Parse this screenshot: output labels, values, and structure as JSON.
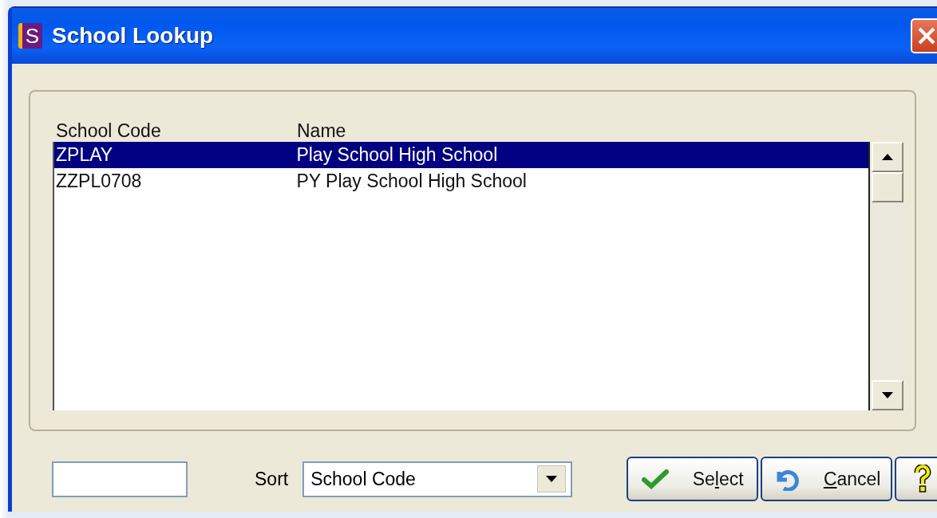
{
  "window": {
    "title": "School Lookup",
    "app_icon_letter": "S"
  },
  "table": {
    "columns": [
      "School Code",
      "Name"
    ],
    "rows": [
      {
        "cells": [
          "ZPLAY",
          "Play School High School"
        ],
        "selected": true
      },
      {
        "cells": [
          "ZZPL0708",
          "PY Play School High School"
        ],
        "selected": false
      }
    ]
  },
  "sort": {
    "label": "Sort",
    "value": "School Code"
  },
  "buttons": [
    {
      "kind": "select",
      "before": "Se",
      "key": "l",
      "after": "ect"
    },
    {
      "kind": "cancel",
      "key": "C",
      "after": "ancel"
    },
    {
      "kind": "help"
    }
  ]
}
